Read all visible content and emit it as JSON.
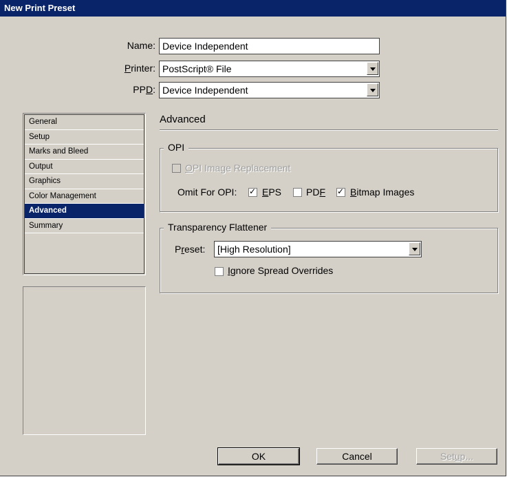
{
  "window": {
    "title": "New Print Preset"
  },
  "form": {
    "name_label": "Name:",
    "name_value": "Device Independent",
    "printer_label_pre": "",
    "printer_label_u": "P",
    "printer_label_post": "rinter:",
    "printer_value": "PostScript® File",
    "ppd_label_pre": "PP",
    "ppd_label_u": "D",
    "ppd_label_post": ":",
    "ppd_value": "Device Independent"
  },
  "sidebar": {
    "items": [
      {
        "label": "General"
      },
      {
        "label": "Setup"
      },
      {
        "label": "Marks and Bleed"
      },
      {
        "label": "Output"
      },
      {
        "label": "Graphics"
      },
      {
        "label": "Color Management"
      },
      {
        "label": "Advanced",
        "selected": true
      },
      {
        "label": "Summary"
      }
    ]
  },
  "panel": {
    "title": "Advanced",
    "opi": {
      "legend": "OPI",
      "image_replacement_u": "O",
      "image_replacement_rest": "PI Image Replacement",
      "image_replacement_checked": false,
      "omit_label": "Omit For OPI:",
      "eps_u": "E",
      "eps_rest": "PS",
      "eps_checked": true,
      "pdf_pre": "PD",
      "pdf_u": "F",
      "pdf_checked": false,
      "bitmap_u": "B",
      "bitmap_rest": "itmap Images",
      "bitmap_checked": true
    },
    "flattener": {
      "legend": "Transparency Flattener",
      "preset_pre": "P",
      "preset_u": "r",
      "preset_post": "eset:",
      "preset_value": "[High Resolution]",
      "ignore_u": "I",
      "ignore_rest": "gnore Spread Overrides",
      "ignore_checked": false
    }
  },
  "buttons": {
    "ok": "OK",
    "cancel": "Cancel",
    "setup_pre": "Set",
    "setup_u": "u",
    "setup_post": "p..."
  }
}
